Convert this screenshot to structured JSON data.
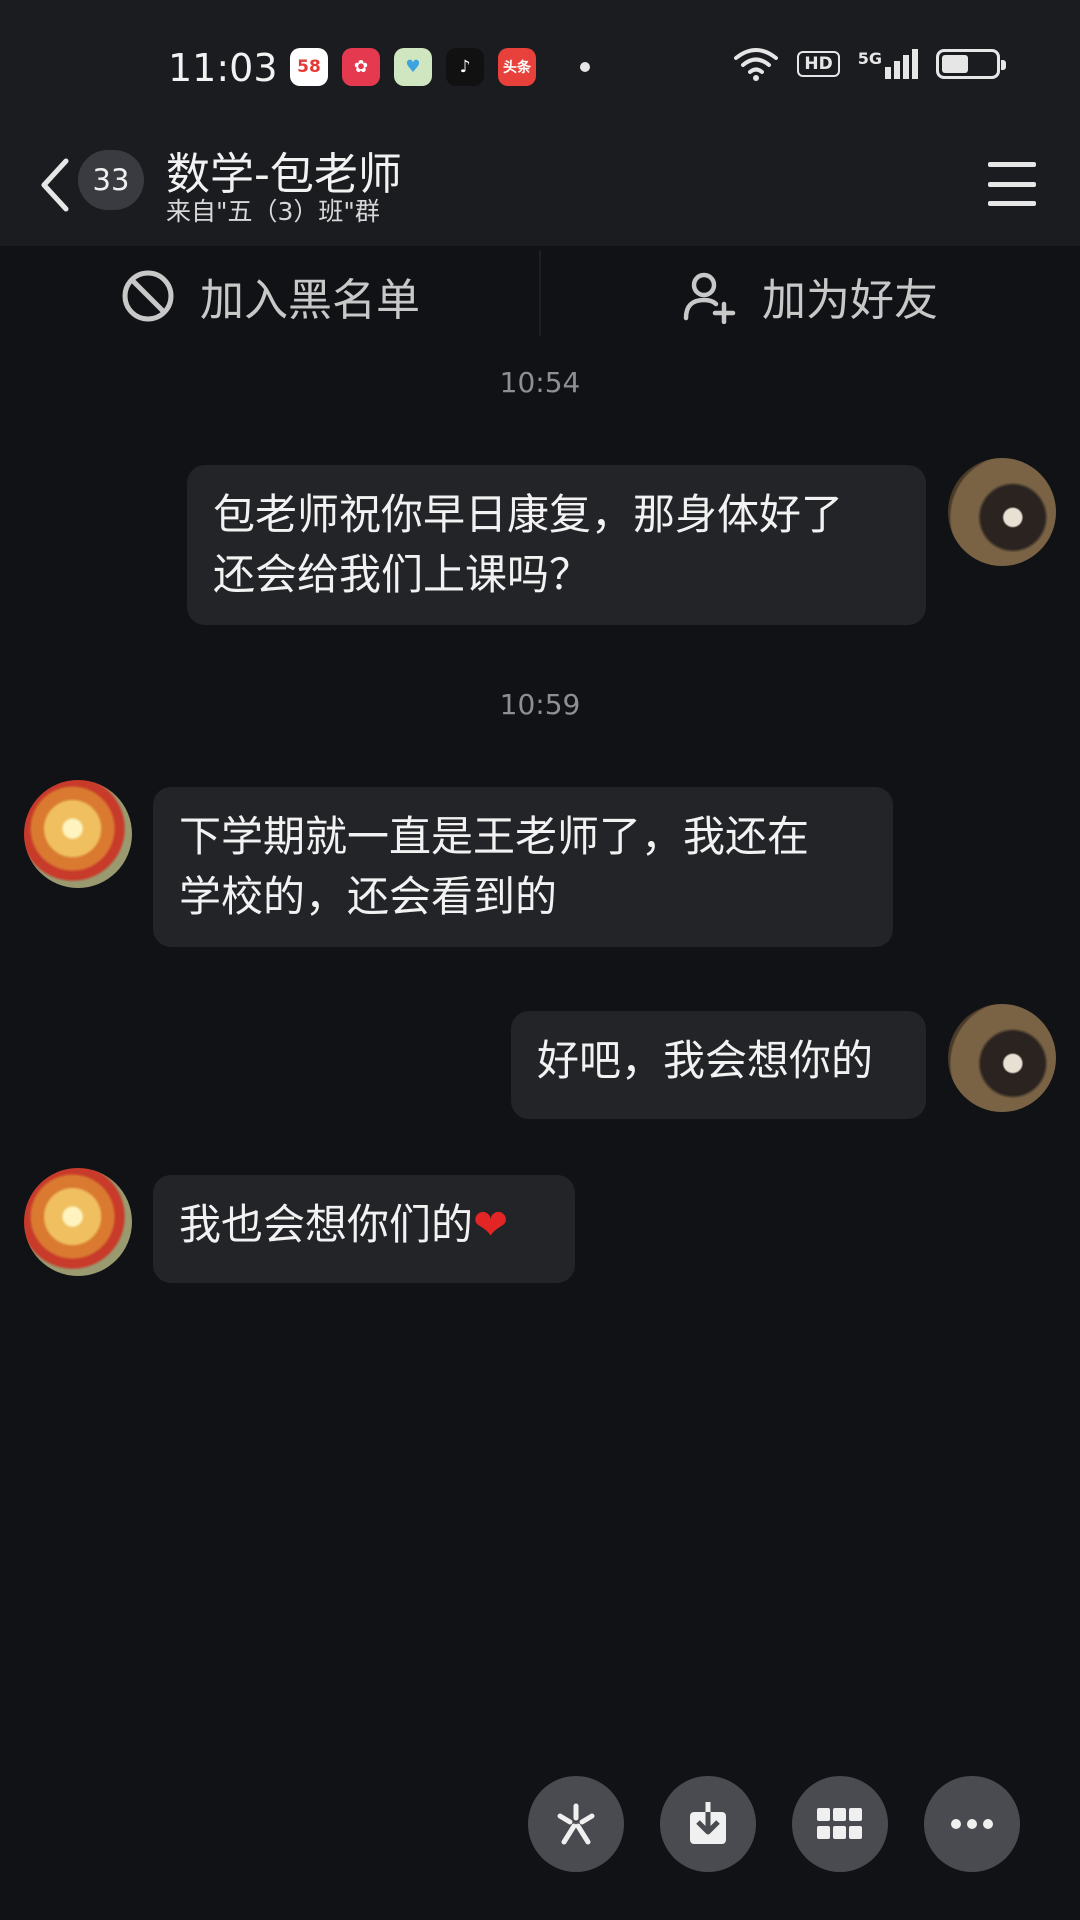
{
  "status_bar": {
    "time": "11:03",
    "notification_apps": [
      {
        "icon": "58-app-icon",
        "label": "58",
        "color": "#e53935"
      },
      {
        "icon": "red-app-icon",
        "label": "✿",
        "color": "#e53950"
      },
      {
        "icon": "heart-app-icon",
        "label": "♥",
        "color": "#cfe6c0"
      },
      {
        "icon": "tiktok-icon",
        "label": "♪",
        "color": "#111111"
      },
      {
        "icon": "toutiao-icon",
        "label": "头条",
        "color": "#e8403a"
      }
    ],
    "hd": "HD",
    "network": "5G",
    "battery_level": 0.5
  },
  "header": {
    "unread_count": "33",
    "title": "数学-包老师",
    "subtitle": "来自\"五（3）班\"群"
  },
  "actions": {
    "blacklist_label": "加入黑名单",
    "add_friend_label": "加为好友"
  },
  "chat": {
    "time_1": "10:54",
    "time_2": "10:59",
    "msg_1_line_1": "包老师祝你早日康复，那身体好了",
    "msg_1_line_2": "还会给我们上课吗？",
    "msg_2_line_1": "下学期就一直是王老师了，我还在",
    "msg_2_line_2": "学校的，还会看到的",
    "msg_3": "好吧，我会想你的",
    "msg_4": "我也会想你们的",
    "msg_4_emoji": "❤"
  },
  "colors": {
    "background": "#111215",
    "bar": "#1b1c20",
    "bubble": "#232428",
    "heart": "#e32525"
  }
}
